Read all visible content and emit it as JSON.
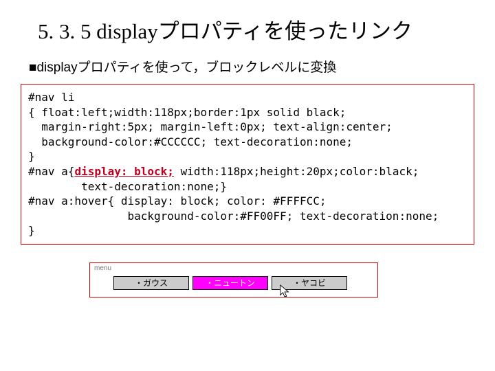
{
  "title": "5. 3. 5 displayプロパティを使ったリンク",
  "subtitle": "■displayプロパティを使って，ブロックレベルに変換",
  "code": {
    "line1": "#nav li",
    "line2": "{ float:left;width:118px;border:1px solid black;",
    "line3": "  margin-right:5px; margin-left:0px; text-align:center;",
    "line4": "  background-color:#CCCCCC; text-decoration:none;",
    "line5": "}",
    "line6a": "#nav a{",
    "line6hl": "display: block;",
    "line6b": " width:118px;height:20px;color:black;",
    "line7": "        text-decoration:none;}",
    "line8": "#nav a:hover{ display: block; color: #FFFFCC;",
    "line9": "               background-color:#FF00FF; text-decoration:none;",
    "line10": "}"
  },
  "demo": {
    "label": "menu",
    "items": [
      "・ガウス",
      "・ニュートン",
      "・ヤコビ"
    ],
    "hoverIndex": 1
  }
}
